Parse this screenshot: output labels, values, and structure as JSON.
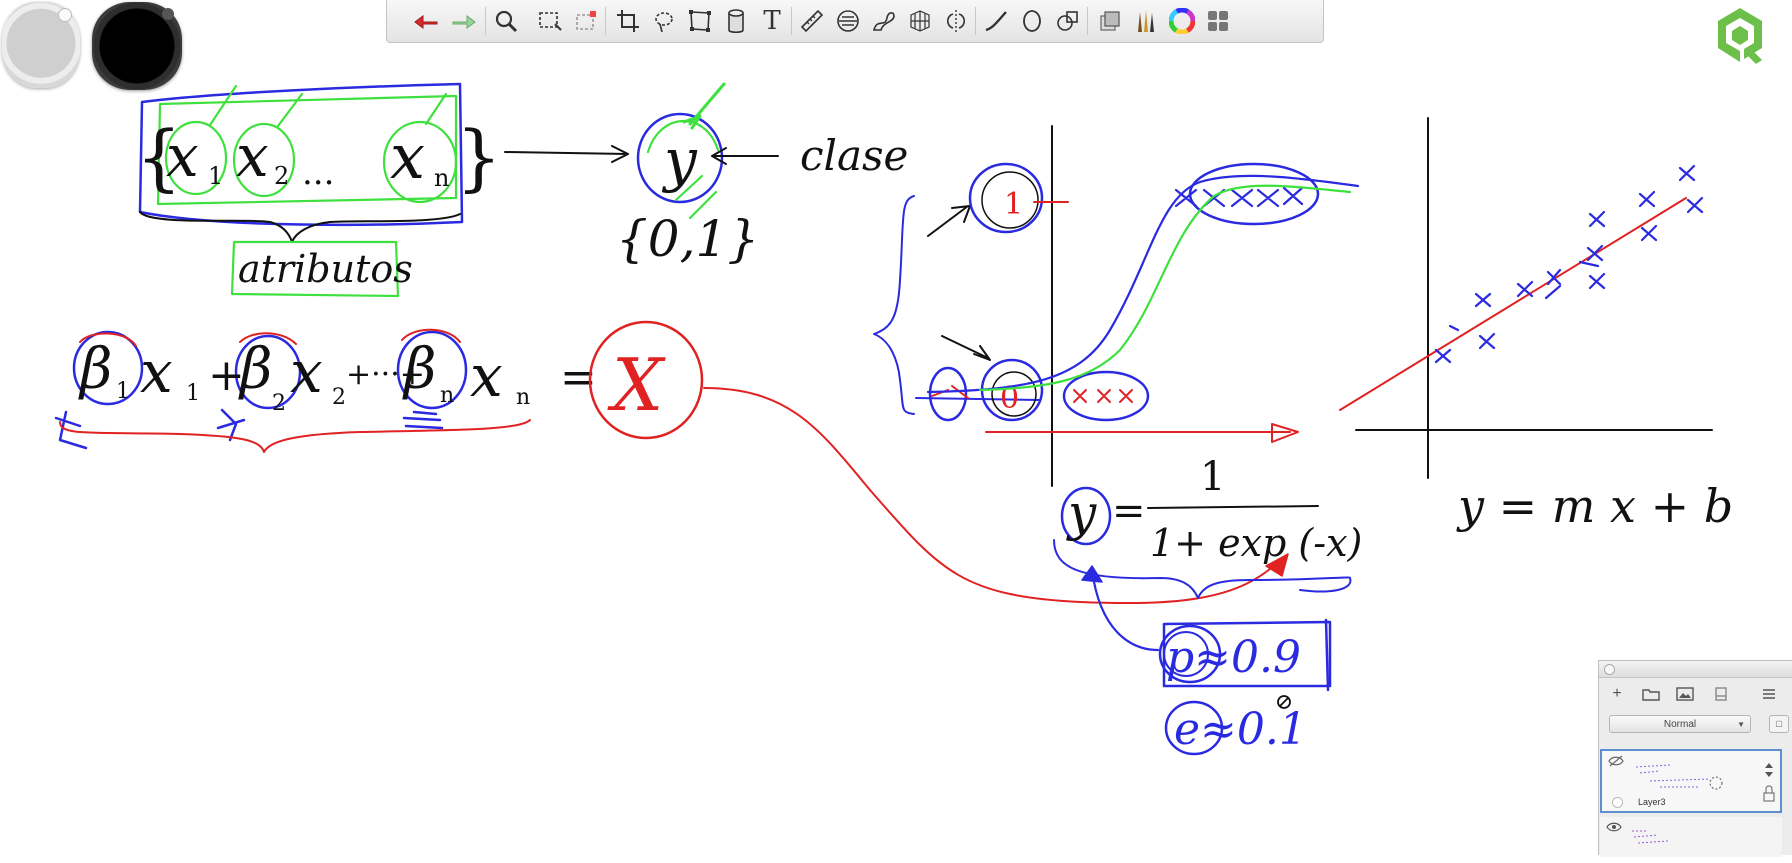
{
  "toolbar": {
    "tools": [
      {
        "name": "undo-button",
        "icon": "undo-arrow-icon"
      },
      {
        "name": "redo-button",
        "icon": "redo-arrow-icon"
      },
      {
        "name": "zoom-button",
        "icon": "magnifier-icon"
      },
      {
        "name": "select-button",
        "icon": "marquee-select-icon"
      },
      {
        "name": "transform-select-button",
        "icon": "dashed-select-icon"
      },
      {
        "name": "crop-button",
        "icon": "crop-icon"
      },
      {
        "name": "lasso-button",
        "icon": "lasso-icon"
      },
      {
        "name": "distort-button",
        "icon": "distort-icon"
      },
      {
        "name": "paint-bucket-button",
        "icon": "bucket-icon"
      },
      {
        "name": "text-button",
        "icon": "text-icon",
        "glyph": "T"
      },
      {
        "name": "ruler-button",
        "icon": "ruler-icon"
      },
      {
        "name": "ellipse-guide-button",
        "icon": "ellipse-guide-icon"
      },
      {
        "name": "french-curve-button",
        "icon": "french-curve-icon"
      },
      {
        "name": "perspective-button",
        "icon": "perspective-grid-icon"
      },
      {
        "name": "symmetry-button",
        "icon": "symmetry-icon"
      },
      {
        "name": "stroke-button",
        "icon": "stroke-icon"
      },
      {
        "name": "ellipse-button",
        "icon": "circle-icon"
      },
      {
        "name": "shape-button",
        "icon": "shapes-icon"
      },
      {
        "name": "layers-button",
        "icon": "layers-icon"
      },
      {
        "name": "brushes-button",
        "icon": "brush-library-icon"
      },
      {
        "name": "color-wheel-button",
        "icon": "color-wheel-icon"
      },
      {
        "name": "menu-grid-button",
        "icon": "grid-menu-icon"
      }
    ]
  },
  "colors": {
    "puck_grey": "#cfcfcf",
    "puck_black": "#000000",
    "brand": "#6cc04a",
    "ink_blue": "#2a2ae0",
    "ink_red": "#e02222",
    "ink_green": "#3ee03e",
    "ink_black": "#111111",
    "ui_accent": "#5d8fd0"
  },
  "canvas": {
    "attrs_set": {
      "open": "{",
      "x1": "x",
      "sub1": "1",
      "x2": "x",
      "sub2": "2",
      "dots": "...",
      "xn": "x",
      "subn": "n",
      "close": "}"
    },
    "attributes_label": "atributos",
    "y_label": "y",
    "clase_label": "clase",
    "class_set": "{0,1}",
    "linear": {
      "b1": "β",
      "b1_sub": "1",
      "x1": "x",
      "x1_sub": "1",
      "plus1": "+",
      "b2": "β",
      "b2_sub": "2",
      "x2": "x",
      "x2_sub": "2",
      "dots": "+···+",
      "bn": "β",
      "bn_sub": "n",
      "xn": "x",
      "xn_sub": "n",
      "eq": "=",
      "result": "X"
    },
    "sigmoid_one": "1",
    "sigmoid_zero": "0",
    "sigmoid_formula": {
      "lhs": "y",
      "eq": "=",
      "numerator": "1",
      "denominator": "1+ exp (-x)"
    },
    "line_formula": "y = m x + b",
    "p_approx": "p≈0.9",
    "e_approx": "e≈0.1"
  },
  "layers_panel": {
    "blend_mode": "Normal",
    "layers": [
      {
        "name": "Layer3",
        "selected": true
      },
      {
        "name": "",
        "selected": false
      }
    ]
  }
}
